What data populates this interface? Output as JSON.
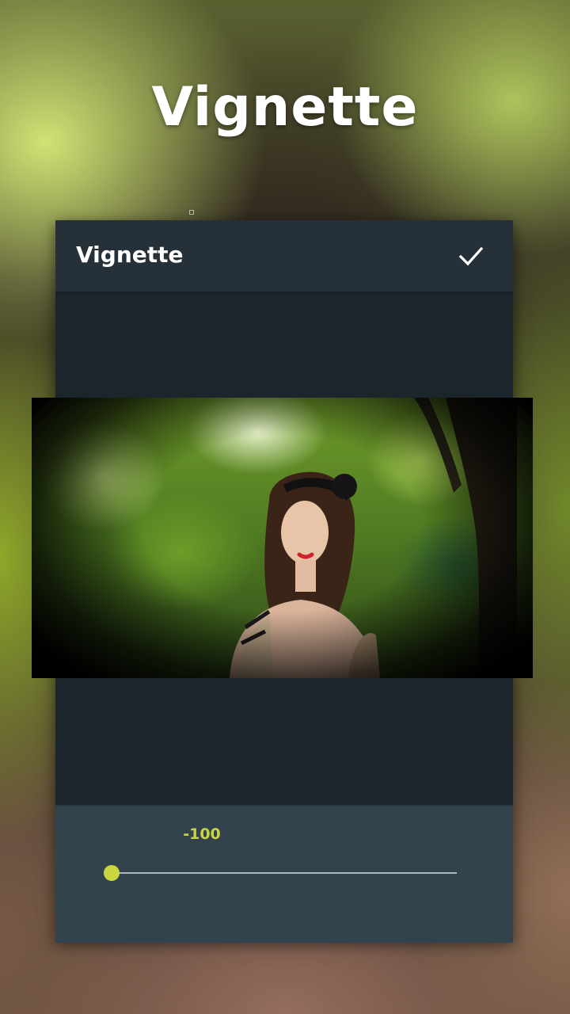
{
  "hero": {
    "title": "Vignette"
  },
  "editor": {
    "toolbar": {
      "title": "Vignette",
      "confirm_icon": "checkmark-icon"
    },
    "slider": {
      "value_label": "-100",
      "value": -100,
      "accent_color": "#c9d640"
    }
  },
  "colors": {
    "panel_background": "#1d252c",
    "toolbar_background": "#263039",
    "slider_panel_background": "#33434d",
    "accent": "#c9d640"
  }
}
